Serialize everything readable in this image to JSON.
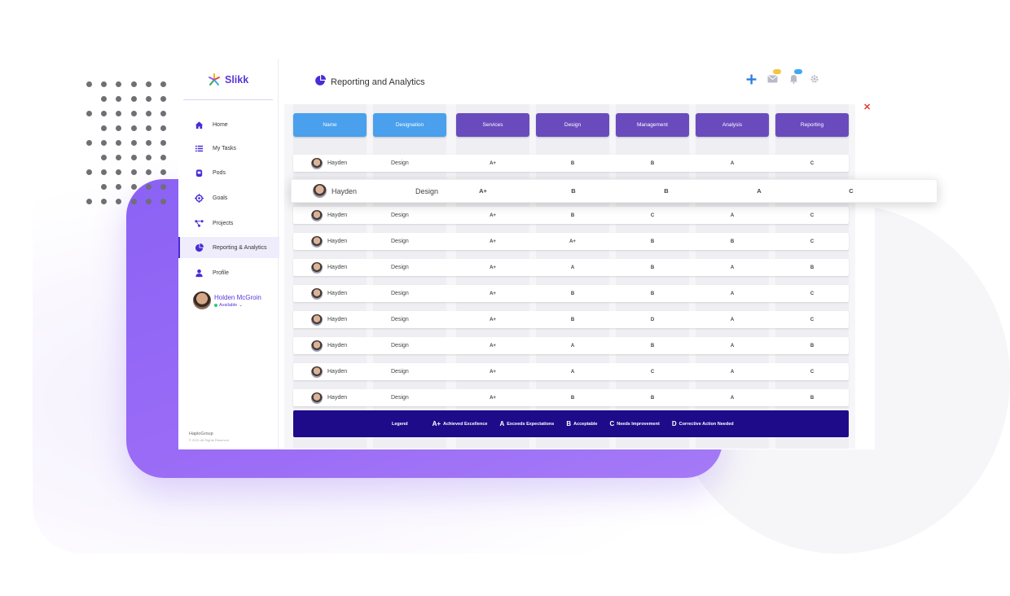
{
  "app": {
    "name": "Slikk",
    "page_title": "Reporting and Analytics",
    "brand_color": "#5a36d9"
  },
  "sidebar": {
    "items": [
      {
        "label": "Home",
        "icon": "home-icon"
      },
      {
        "label": "My Tasks",
        "icon": "list-icon"
      },
      {
        "label": "Pods",
        "icon": "pod-icon"
      },
      {
        "label": "Goals",
        "icon": "target-icon"
      },
      {
        "label": "Projects",
        "icon": "project-icon"
      },
      {
        "label": "Reporting & Analytics",
        "icon": "pie-chart-icon",
        "active": true
      },
      {
        "label": "Profile",
        "icon": "user-icon"
      }
    ],
    "user": {
      "name": "Holden McGroin",
      "status": "Available"
    },
    "footer": {
      "org": "HaploGroup",
      "copyright": "© 2021 All Rights Reserved"
    }
  },
  "header": {
    "icons": [
      "plus-icon",
      "mail-icon",
      "bell-icon",
      "gear-icon"
    ],
    "mail_badge_color": "#f5c542",
    "bell_badge_color": "#3fa8f4"
  },
  "table": {
    "columns": [
      "Name",
      "Designation",
      "Services",
      "Design",
      "Management",
      "Analysis",
      "Reporting"
    ],
    "rows": [
      {
        "name": "Hayden",
        "designation": "Design",
        "grades": [
          "A+",
          "B",
          "B",
          "A",
          "C"
        ]
      },
      {
        "name": "Hayden",
        "designation": "Design",
        "grades": [
          "A+",
          "B",
          "B",
          "A",
          "C"
        ]
      },
      {
        "name": "Hayden",
        "designation": "Design",
        "grades": [
          "A+",
          "B",
          "C",
          "A",
          "C"
        ]
      },
      {
        "name": "Hayden",
        "designation": "Design",
        "grades": [
          "A+",
          "A+",
          "B",
          "B",
          "C"
        ]
      },
      {
        "name": "Hayden",
        "designation": "Design",
        "grades": [
          "A+",
          "A",
          "B",
          "A",
          "B"
        ]
      },
      {
        "name": "Hayden",
        "designation": "Design",
        "grades": [
          "A+",
          "B",
          "B",
          "A",
          "C"
        ]
      },
      {
        "name": "Hayden",
        "designation": "Design",
        "grades": [
          "A+",
          "B",
          "D",
          "A",
          "C"
        ]
      },
      {
        "name": "Hayden",
        "designation": "Design",
        "grades": [
          "A+",
          "A",
          "B",
          "A",
          "B"
        ]
      },
      {
        "name": "Hayden",
        "designation": "Design",
        "grades": [
          "A+",
          "A",
          "C",
          "A",
          "C"
        ]
      },
      {
        "name": "Hayden",
        "designation": "Design",
        "grades": [
          "A+",
          "B",
          "B",
          "A",
          "B"
        ]
      }
    ]
  },
  "legend": {
    "title": "Legend",
    "items": [
      {
        "code": "A+",
        "text": "Achieved Excellence"
      },
      {
        "code": "A",
        "text": "Exceeds Expectations"
      },
      {
        "code": "B",
        "text": "Acceptable"
      },
      {
        "code": "C",
        "text": "Needs Improvement"
      },
      {
        "code": "D",
        "text": "Corrective Action Needed"
      }
    ]
  }
}
